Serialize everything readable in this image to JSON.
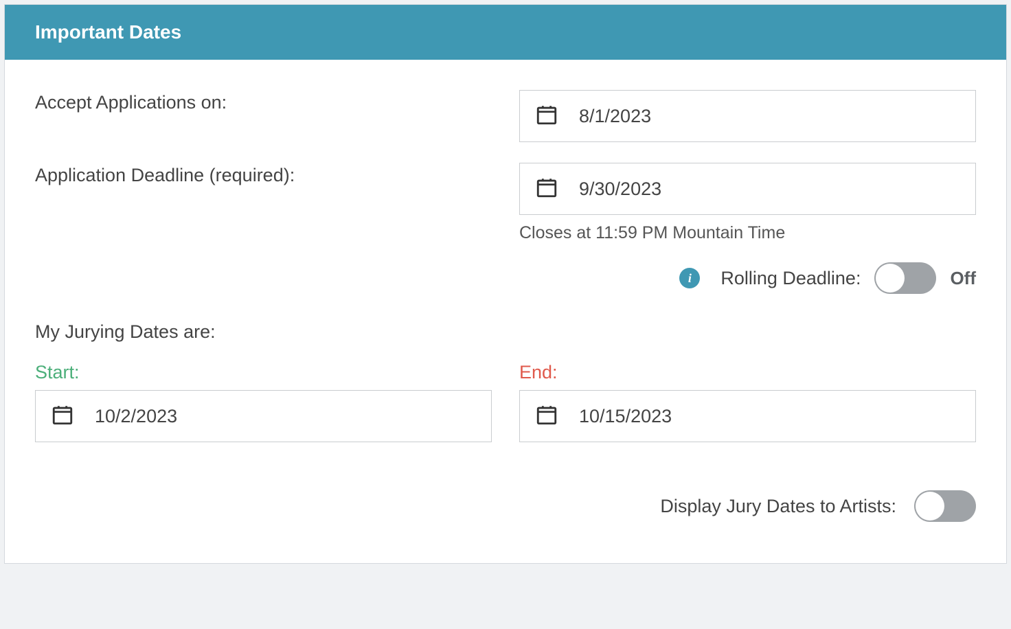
{
  "panel": {
    "title": "Important Dates"
  },
  "fields": {
    "accept_applications": {
      "label": "Accept Applications on:",
      "value": "8/1/2023"
    },
    "application_deadline": {
      "label": "Application Deadline (required):",
      "value": "9/30/2023",
      "help": "Closes at 11:59 PM Mountain Time"
    },
    "rolling_deadline": {
      "label": "Rolling Deadline:",
      "state": "Off"
    },
    "jurying_header": "My Jurying Dates are:",
    "jury_start": {
      "label": "Start:",
      "value": "10/2/2023"
    },
    "jury_end": {
      "label": "End:",
      "value": "10/15/2023"
    },
    "display_jury_dates": {
      "label": "Display Jury Dates to Artists:"
    }
  }
}
